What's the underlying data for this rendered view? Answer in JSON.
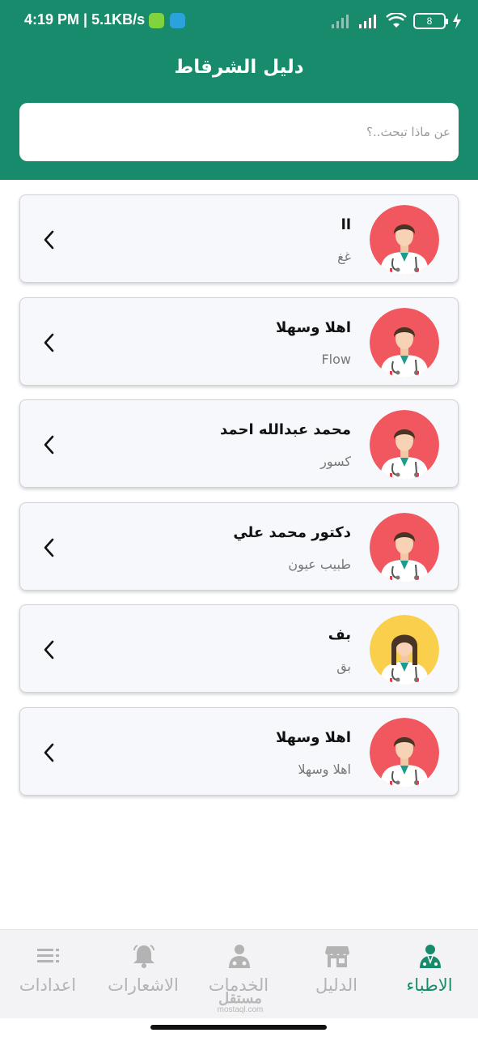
{
  "status_bar": {
    "time": "4:19 PM | 5.1KB/s",
    "battery": "8"
  },
  "header": {
    "title": "دليل الشرقاط"
  },
  "search": {
    "value": "",
    "placeholder": "عن ماذا تبحث..؟"
  },
  "doctors": [
    {
      "name": "ll",
      "specialty": "غغ",
      "avatar": "male-doctor-icon"
    },
    {
      "name": "اهلا وسهلا",
      "specialty": "Flow",
      "avatar": "male-doctor-icon"
    },
    {
      "name": "محمد عبدالله احمد",
      "specialty": "كسور",
      "avatar": "male-doctor-icon"
    },
    {
      "name": "دكتور محمد علي",
      "specialty": "طبيب عيون",
      "avatar": "male-doctor-icon"
    },
    {
      "name": "بف",
      "specialty": "بق",
      "avatar": "female-doctor-icon"
    },
    {
      "name": "اهلا وسهلا",
      "specialty": "اهلا وسهلا",
      "avatar": "male-doctor-icon"
    }
  ],
  "bottom_nav": {
    "items": [
      {
        "label": "الاطباء",
        "icon": "doctor-icon",
        "active": true
      },
      {
        "label": "الدليل",
        "icon": "store-icon",
        "active": false
      },
      {
        "label": "الخدمات",
        "icon": "services-icon",
        "active": false
      },
      {
        "label": "الاشعارات",
        "icon": "bell-icon",
        "active": false
      },
      {
        "label": "اعدادات",
        "icon": "menu-icon",
        "active": false
      }
    ]
  },
  "watermark": {
    "ar": "مستقل",
    "en": "mostaql.com"
  },
  "colors": {
    "primary": "#178b6b",
    "avatar_male_bg": "#f0575f",
    "avatar_female_bg": "#f9cf4c",
    "inactive": "#b3b3b3"
  }
}
